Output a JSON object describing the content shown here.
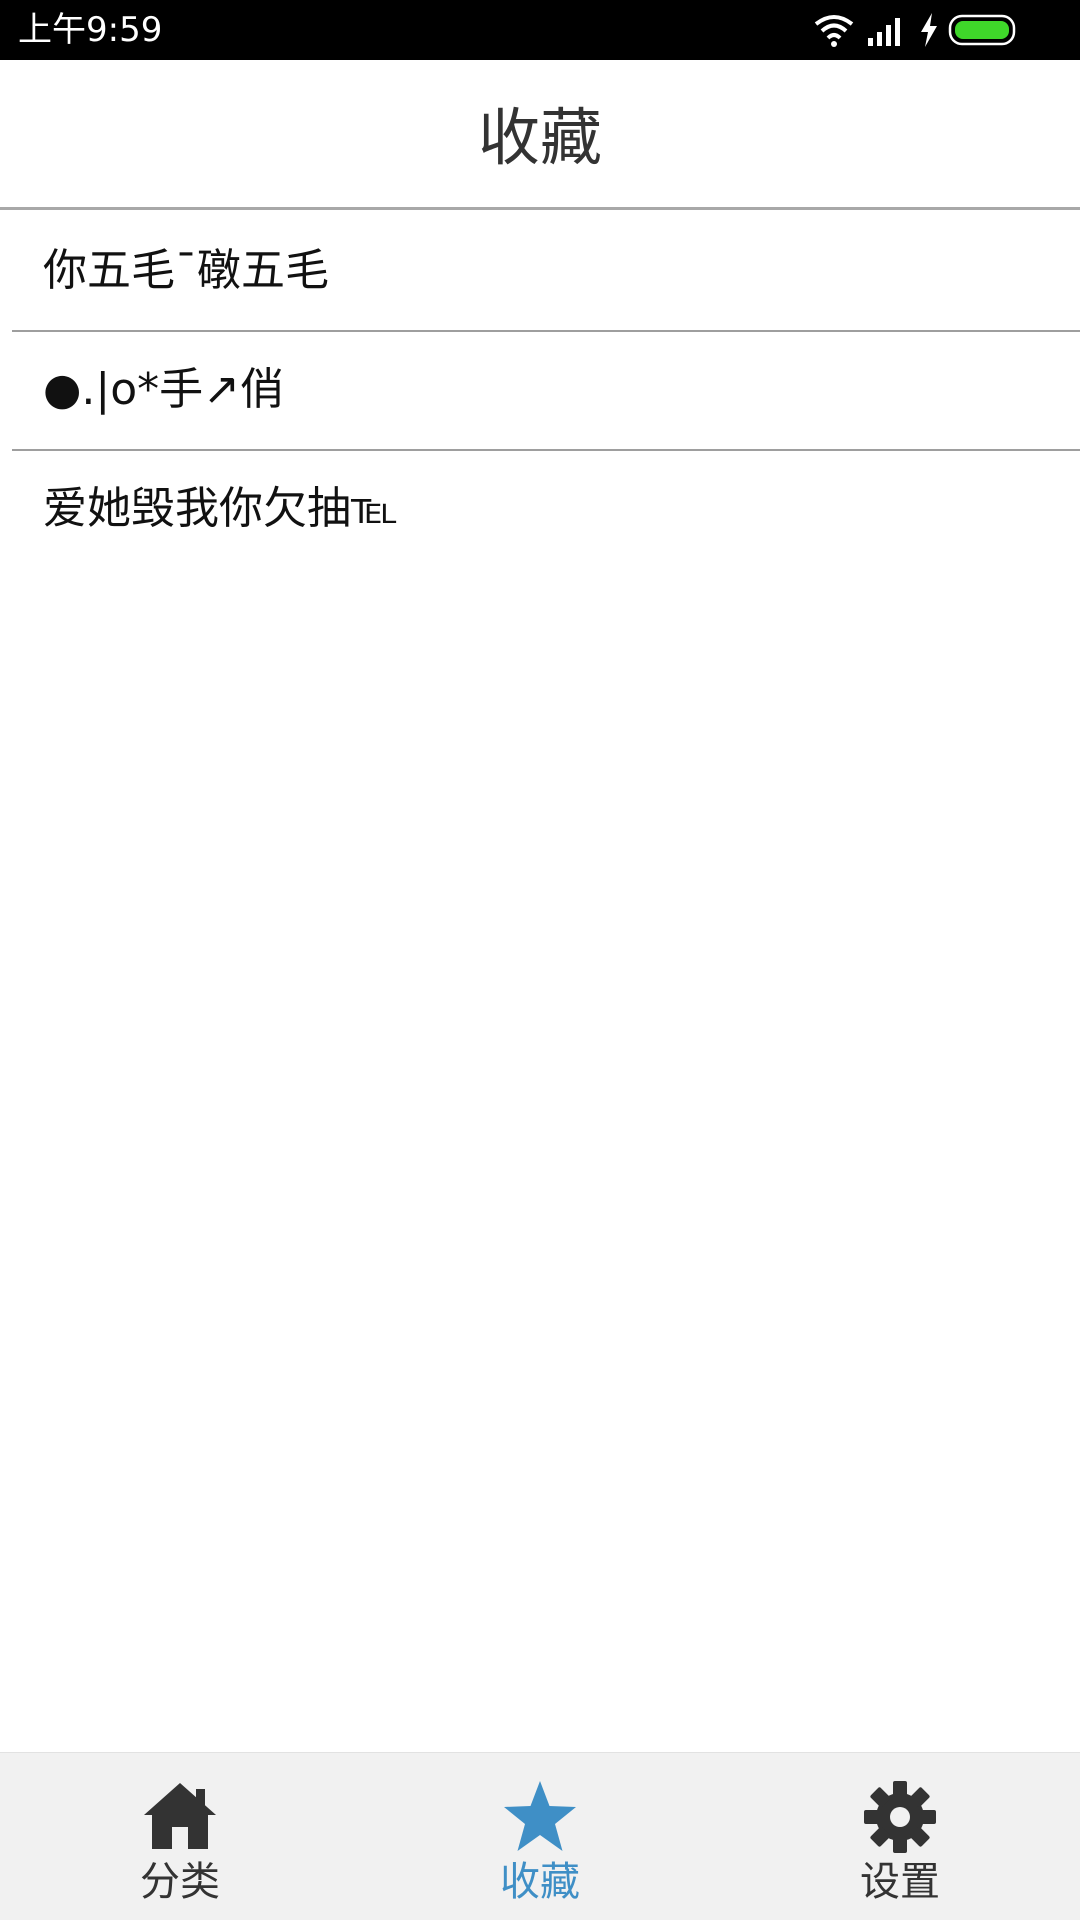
{
  "status_bar": {
    "time": "上午9:59",
    "icons": [
      "wifi-icon",
      "signal-icon",
      "charging-icon",
      "battery-icon"
    ],
    "battery_color": "#3fd72a"
  },
  "header": {
    "title": "收藏"
  },
  "favorites": [
    {
      "text": "你五毛ˉ礅五毛"
    },
    {
      "text": "●.|o*手↗俏"
    },
    {
      "text": "爱她毁我你欠抽℡"
    }
  ],
  "tab_bar": {
    "active_color": "#3f8fc6",
    "inactive_color": "#333333",
    "tabs": [
      {
        "label": "分类",
        "icon": "home-icon",
        "active": false
      },
      {
        "label": "收藏",
        "icon": "star-icon",
        "active": true
      },
      {
        "label": "设置",
        "icon": "gear-icon",
        "active": false
      }
    ]
  }
}
